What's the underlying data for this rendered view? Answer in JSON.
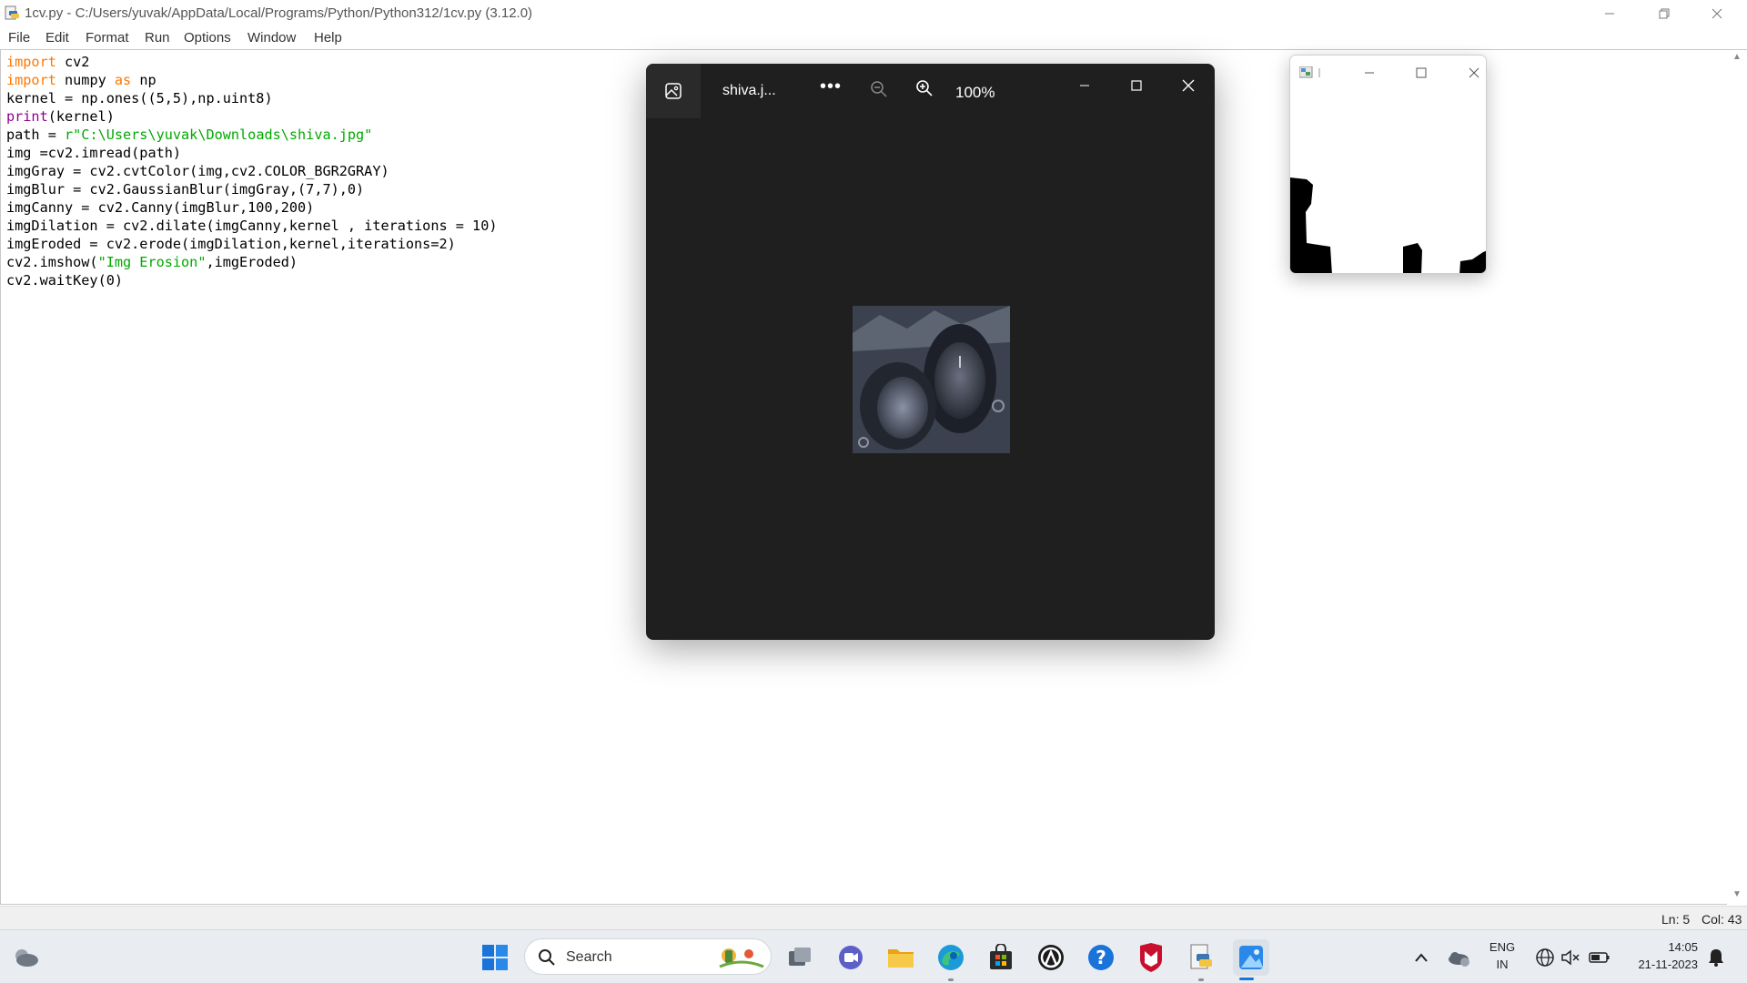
{
  "editor_window": {
    "title": "1cv.py - C:/Users/yuvak/AppData/Local/Programs/Python/Python312/1cv.py (3.12.0)",
    "menu": [
      "File",
      "Edit",
      "Format",
      "Run",
      "Options",
      "Window",
      "Help"
    ],
    "code_lines": [
      [
        {
          "t": "import",
          "c": "kw"
        },
        {
          "t": " cv2"
        }
      ],
      [
        {
          "t": "import",
          "c": "kw"
        },
        {
          "t": " numpy "
        },
        {
          "t": "as",
          "c": "kw"
        },
        {
          "t": " np"
        }
      ],
      [
        {
          "t": "kernel = np.ones((5,5),np.uint8)"
        }
      ],
      [
        {
          "t": "print",
          "c": "bi"
        },
        {
          "t": "(kernel)"
        }
      ],
      [
        {
          "t": "path = "
        },
        {
          "t": "r\"C:\\Users\\yuvak\\Downloads\\shiva.jpg\"",
          "c": "st"
        }
      ],
      [
        {
          "t": "img =cv2.imread(path)"
        }
      ],
      [
        {
          "t": "imgGray = cv2.cvtColor(img,cv2.COLOR_BGR2GRAY)"
        }
      ],
      [
        {
          "t": "imgBlur = cv2.GaussianBlur(imgGray,(7,7),0)"
        }
      ],
      [
        {
          "t": "imgCanny = cv2.Canny(imgBlur,100,200)"
        }
      ],
      [
        {
          "t": "imgDilation = cv2.dilate(imgCanny,kernel , iterations = 10)"
        }
      ],
      [
        {
          "t": "imgEroded = cv2.erode(imgDilation,kernel,iterations=2)"
        }
      ],
      [
        {
          "t": "cv2.imshow("
        },
        {
          "t": "\"Img Erosion\"",
          "c": "st"
        },
        {
          "t": ",imgEroded)"
        }
      ],
      [
        {
          "t": "cv2.waitKey(0)"
        }
      ]
    ],
    "status": {
      "line": "Ln: 5",
      "col": "Col: 43"
    }
  },
  "photos_window": {
    "file_name": "shiva.j...",
    "more_label": "•••",
    "zoom_level": "100%"
  },
  "taskbar": {
    "search_label": "Search",
    "language_top": "ENG",
    "language_bottom": "IN",
    "time": "14:05",
    "date": "21-11-2023"
  },
  "colors": {
    "keyword": "#ff7700",
    "builtin": "#900090",
    "string": "#00aa00",
    "photos_bg": "#1f1f1f",
    "taskbar_bg": "#e9edf2",
    "accent": "#1a73d9"
  }
}
